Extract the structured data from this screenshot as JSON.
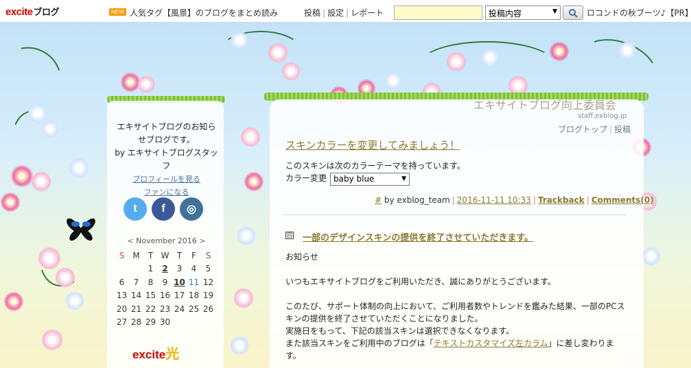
{
  "topbar": {
    "logo_main": "excite",
    "logo_sub": "ブログ",
    "new_badge": "NEW",
    "tag_link": "人気タグ【風景】のブログをまとめ読み",
    "links": [
      "投稿",
      "設定",
      "レポート"
    ],
    "search_value": "",
    "search_scope": "投稿内容",
    "ad_text": "ロコンドの秋ブーツ♪【PR】"
  },
  "sidebar": {
    "profile_lines": [
      "エキサイトブログのお知ら",
      "せブログです。",
      "by エキサイトブログスタッフ"
    ],
    "profile_link": "プロフィールを見る",
    "fan_link": "ファンになる",
    "social": [
      {
        "icon": "twitter-icon",
        "glyph": "t",
        "color": "#55acee"
      },
      {
        "icon": "facebook-icon",
        "glyph": "f",
        "color": "#3b5998"
      },
      {
        "icon": "instagram-icon",
        "glyph": "◎",
        "color": "#3f729b"
      }
    ],
    "calendar": {
      "prev": "<",
      "month": "November 2016",
      "next": ">",
      "weekdays": [
        "S",
        "M",
        "T",
        "W",
        "T",
        "F",
        "S"
      ],
      "weeks": [
        [
          "",
          "",
          "1",
          "2",
          "3",
          "4",
          "5"
        ],
        [
          "6",
          "7",
          "8",
          "9",
          "10",
          "11",
          "12"
        ],
        [
          "13",
          "14",
          "15",
          "16",
          "17",
          "18",
          "19"
        ],
        [
          "20",
          "21",
          "22",
          "23",
          "24",
          "25",
          "26"
        ],
        [
          "27",
          "28",
          "29",
          "30",
          "",
          "",
          ""
        ]
      ]
    },
    "bottom_logo": "excite",
    "bottom_logo_suffix": "光"
  },
  "main": {
    "blog_title": "エキサイトブログ向上委員会",
    "blog_url": "staff.exblog.jp",
    "blog_links": [
      "ブログトップ",
      "投稿"
    ],
    "post1": {
      "title": "スキンカラーを変更してみましょう！",
      "body": "このスキンは次のカラーテーマを持っています。",
      "color_label": "カラー変更",
      "color_value": "baby blue",
      "meta_hash": "#",
      "meta_by": "by exblog_team",
      "meta_date": "2016-11-11 10:33",
      "meta_trackback": "Trackback",
      "meta_comments": "Comments(0)"
    },
    "post2": {
      "icon_glyph": "回",
      "title": "一部のデザインスキンの提供を終了させていただきます。",
      "para1": "お知らせ",
      "para2": "いつもエキサイトブログをご利用いただき、誠にありがとうございます。",
      "para3_line1": "このたび、サポート体制の向上において、ご利用者数やトレンドを鑑みた結果、一部のPCス",
      "para3_line2": "キンの提供を終了させていただくことになりました。",
      "para3_line3": "実施日をもって、下記の該当スキンは選択できなくなります。",
      "para3_line4_pre": "また該当スキンをご利用中のブログは「",
      "para3_line4_link": "テキストカスタマイズ左カラム",
      "para3_line4_post": "」に差し変わります。"
    }
  },
  "colors": {
    "accent": "#8a7a2e",
    "flower_pink": "#f06aa0",
    "leaf": "#2f7a3a"
  }
}
